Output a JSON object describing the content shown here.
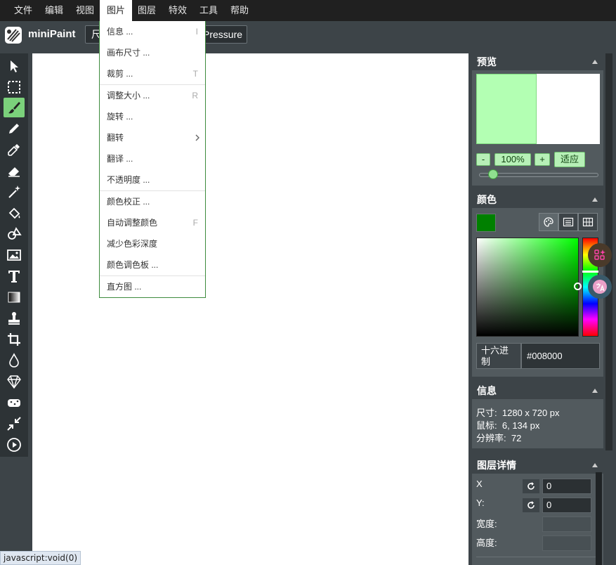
{
  "menubar": {
    "items": [
      "文件",
      "编辑",
      "视图",
      "图片",
      "图层",
      "特效",
      "工具",
      "帮助"
    ],
    "active": "图片"
  },
  "app": {
    "name": "miniPaint"
  },
  "attributes": {
    "size_label": "尺",
    "pressure_label": "Pressure"
  },
  "image_menu": {
    "items": [
      {
        "label": "信息 ...",
        "shortcut": "I"
      },
      {
        "label": "画布尺寸 ...",
        "shortcut": ""
      },
      {
        "label": "裁剪 ...",
        "shortcut": "T"
      },
      {
        "label": "调整大小 ...",
        "shortcut": "R"
      },
      {
        "label": "旋转 ...",
        "shortcut": ""
      },
      {
        "label": "翻转",
        "shortcut": ""
      },
      {
        "label": "翻译 ...",
        "shortcut": ""
      },
      {
        "label": "不透明度 ...",
        "shortcut": ""
      },
      {
        "label": "颜色校正 ...",
        "shortcut": ""
      },
      {
        "label": "自动调整颜色",
        "shortcut": "F"
      },
      {
        "label": "减少色彩深度",
        "shortcut": ""
      },
      {
        "label": "颜色调色板 ...",
        "shortcut": ""
      },
      {
        "label": "直方图 ...",
        "shortcut": ""
      }
    ]
  },
  "tools": [
    "select-icon",
    "selection-icon",
    "brush-icon",
    "pencil-icon",
    "pick-color-icon",
    "erase-icon",
    "magic-wand-icon",
    "fill-icon",
    "shape-icon",
    "image-icon",
    "text-icon",
    "gradient-icon",
    "clone-icon",
    "crop-icon",
    "blur-icon",
    "sharpen-icon",
    "sponge-icon",
    "desaturate-icon",
    "animation-icon"
  ],
  "preview": {
    "title": "预览",
    "zoom_out": "-",
    "zoom_value": "100%",
    "zoom_in": "+",
    "fit": "适应",
    "zoom_slider_fraction": 0.1
  },
  "colors": {
    "title": "颜色",
    "current": "#008000",
    "hex_label": "十六进制",
    "hex_value": "#008000"
  },
  "info": {
    "title": "信息",
    "size_label": "尺寸:",
    "size_value": "1280 x 720 px",
    "mouse_label": "鼠标:",
    "mouse_value": "6, 134 px",
    "resolution_label": "分辨率:",
    "resolution_value": "72"
  },
  "layer_details": {
    "title": "图层详情",
    "x_label": "X",
    "x_value": "0",
    "y_label": "Y:",
    "y_value": "0",
    "width_label": "宽度:",
    "height_label": "高度:"
  },
  "status": {
    "text": "javascript:void(0)"
  },
  "theme": {
    "accent": "#7bd17b",
    "menu_border": "#3d8b3d",
    "panel": "#525a5e"
  }
}
